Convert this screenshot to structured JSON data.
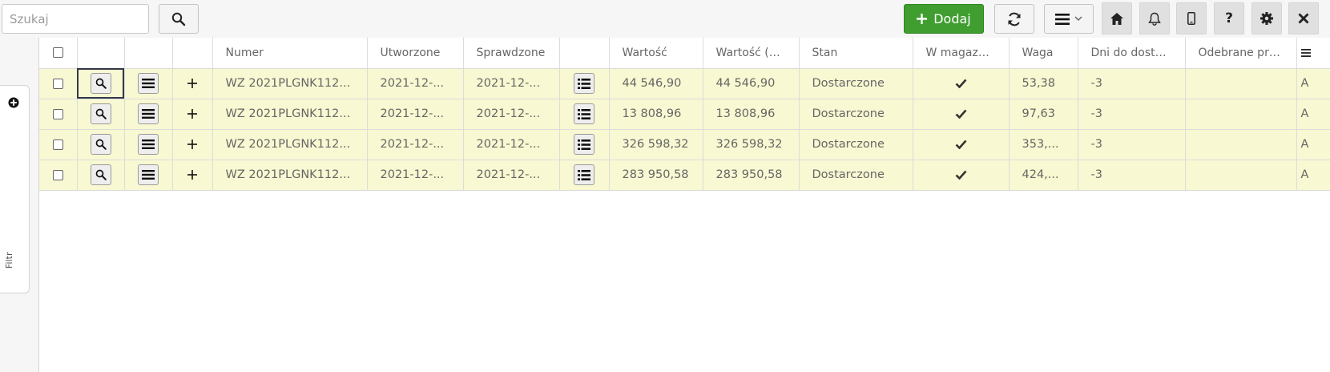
{
  "toolbar": {
    "search_placeholder": "Szukaj",
    "add_label": "Dodaj"
  },
  "filter": {
    "label": "Filtr"
  },
  "table": {
    "headers": {
      "numer": "Numer",
      "utworzone": "Utworzone",
      "sprawdzone": "Sprawdzone",
      "wartosc": "Wartość",
      "wartosc_sp": "Wartość (sp...",
      "stan": "Stan",
      "w_magazynie": "W magazyn...",
      "waga": "Waga",
      "dni_do_dostawy": "Dni do dostawy",
      "odebrane": "Odebrane prz..."
    },
    "rows": [
      {
        "numer": "WZ 2021PLGNK112...",
        "utworzone": "2021-12-...",
        "sprawdzone": "2021-12-...",
        "wartosc": "44 546,90",
        "wartosc_sp": "44 546,90",
        "stan": "Dostarczone",
        "waga": "53,38",
        "dni": "-3",
        "odebrane": "",
        "extra": "A"
      },
      {
        "numer": "WZ 2021PLGNK112...",
        "utworzone": "2021-12-...",
        "sprawdzone": "2021-12-...",
        "wartosc": "13 808,96",
        "wartosc_sp": "13 808,96",
        "stan": "Dostarczone",
        "waga": "97,63",
        "dni": "-3",
        "odebrane": "",
        "extra": "A"
      },
      {
        "numer": "WZ 2021PLGNK112...",
        "utworzone": "2021-12-...",
        "sprawdzone": "2021-12-...",
        "wartosc": "326 598,32",
        "wartosc_sp": "326 598,32",
        "stan": "Dostarczone",
        "waga": "353,...",
        "dni": "-3",
        "odebrane": "",
        "extra": "A"
      },
      {
        "numer": "WZ 2021PLGNK112...",
        "utworzone": "2021-12-...",
        "sprawdzone": "2021-12-...",
        "wartosc": "283 950,58",
        "wartosc_sp": "283 950,58",
        "stan": "Dostarczone",
        "waga": "424,...",
        "dni": "-3",
        "odebrane": "",
        "extra": "A"
      }
    ]
  },
  "icons": {
    "search": "search-icon",
    "add": "plus-icon",
    "refresh": "refresh-icon",
    "menu": "hamburger-icon",
    "home": "home-icon",
    "bell": "bell-icon",
    "mobile": "mobile-icon",
    "help": "help-icon",
    "settings": "gear-icon",
    "close": "close-icon"
  },
  "colors": {
    "add_button": "#3f9e2f",
    "row_background": "#f8f8d2",
    "focus_outline": "#33384a"
  }
}
